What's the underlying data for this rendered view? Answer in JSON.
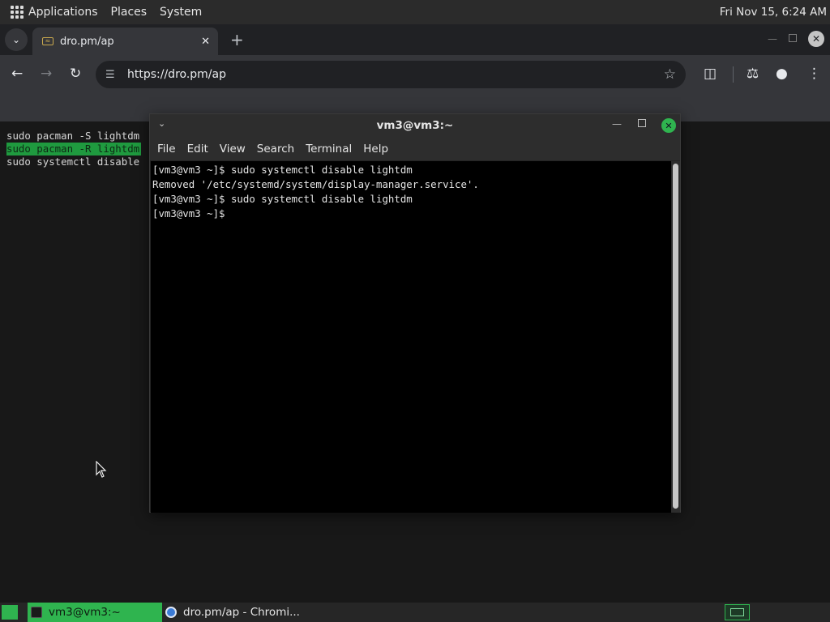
{
  "top_panel": {
    "menus": [
      "Applications",
      "Places",
      "System"
    ],
    "clock": "Fri Nov 15,  6:24 AM"
  },
  "browser": {
    "tab_title": "dro.pm/ap",
    "url": "https://dro.pm/ap",
    "icons": {
      "tab_search": "chevron-down-icon",
      "tab_close": "close-icon",
      "new_tab": "plus-icon",
      "back": "arrow-left-icon",
      "forward": "arrow-right-icon",
      "reload": "reload-icon",
      "site_info": "tune-icon",
      "bookmark": "star-icon",
      "extensions": "puzzle-icon",
      "labs": "flask-icon",
      "profile": "person-icon",
      "menu": "kebab-icon"
    }
  },
  "page": {
    "lines": [
      "sudo pacman -S lightdm",
      "sudo pacman -R lightdm",
      "sudo systemctl disable"
    ],
    "highlighted_line_index": 1,
    "highlight_color": "#1f9a3f"
  },
  "terminal": {
    "title": "vm3@vm3:~",
    "menu": [
      "File",
      "Edit",
      "View",
      "Search",
      "Terminal",
      "Help"
    ],
    "lines": [
      "[vm3@vm3 ~]$ sudo systemctl disable lightdm",
      "Removed '/etc/systemd/system/display-manager.service'.",
      "[vm3@vm3 ~]$ sudo systemctl disable lightdm",
      "[vm3@vm3 ~]$ "
    ],
    "close_button_color": "#2fb44f"
  },
  "taskbar": {
    "tasks": [
      {
        "label": "vm3@vm3:~",
        "active": true
      },
      {
        "label": "dro.pm/ap - Chromi...",
        "active": false
      }
    ],
    "accent": "#2fb44f"
  }
}
